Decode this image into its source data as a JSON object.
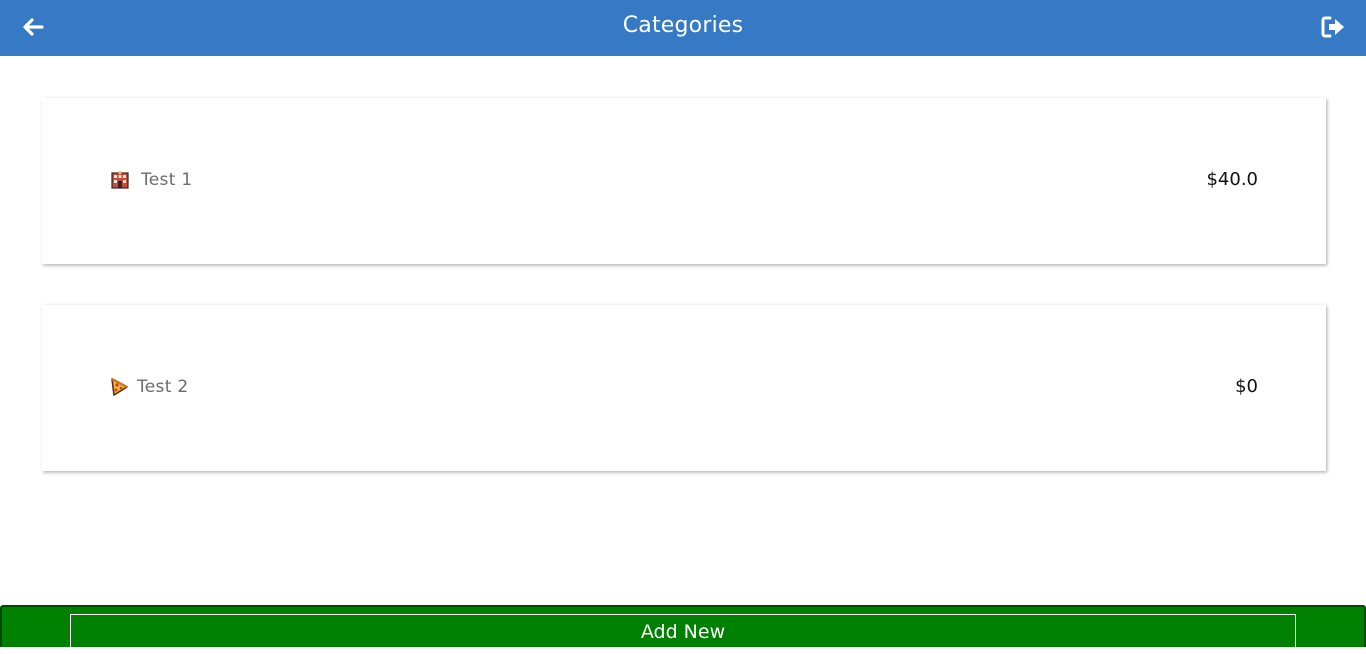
{
  "header": {
    "title": "Categories",
    "back_icon": "arrow-left-icon",
    "logout_icon": "sign-out-icon",
    "background_color": "#3679c4"
  },
  "categories": [
    {
      "name": "Test 1",
      "amount": "$40.0",
      "icon": "office-building-emoji-icon"
    },
    {
      "name": "Test 2",
      "amount": "$0",
      "icon": "pizza-slice-emoji-icon"
    }
  ],
  "footer": {
    "add_label": "Add New",
    "background_color": "#008000"
  }
}
